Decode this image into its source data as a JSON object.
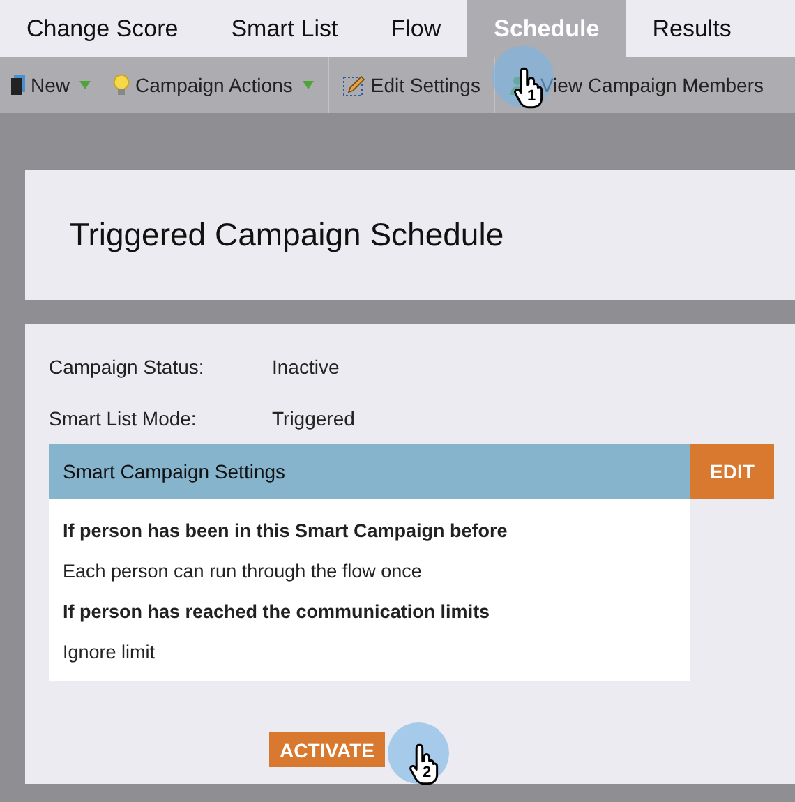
{
  "tabs": [
    {
      "label": "Change Score",
      "selected": false
    },
    {
      "label": "Smart List",
      "selected": false
    },
    {
      "label": "Flow",
      "selected": false
    },
    {
      "label": "Schedule",
      "selected": true
    },
    {
      "label": "Results",
      "selected": false
    }
  ],
  "toolbar": [
    {
      "label": "New",
      "kind": "new",
      "dropdown": true
    },
    {
      "label": "Campaign Actions",
      "kind": "actions",
      "dropdown": true
    },
    {
      "label": "Edit Settings",
      "kind": "edit",
      "dropdown": false
    },
    {
      "label": "View Campaign Members",
      "kind": "members",
      "dropdown": false
    }
  ],
  "title": "Triggered Campaign Schedule",
  "fields": [
    {
      "label": "Campaign Status:",
      "value": "Inactive"
    },
    {
      "label": "Smart List Mode:",
      "value": "Triggered"
    }
  ],
  "settings": {
    "title": "Smart Campaign Settings",
    "edit_button": "EDIT",
    "lines": [
      {
        "text": "If person has been in this Smart Campaign before",
        "kind": "heading"
      },
      {
        "text": "Each person can run through the flow once",
        "kind": "value"
      },
      {
        "text": "If person has reached the communication limits",
        "kind": "heading"
      },
      {
        "text": "Ignore limit",
        "kind": "value"
      }
    ]
  },
  "activate_button": "ACTIVATE",
  "callouts": [
    {
      "step": "1"
    },
    {
      "step": "2"
    }
  ]
}
